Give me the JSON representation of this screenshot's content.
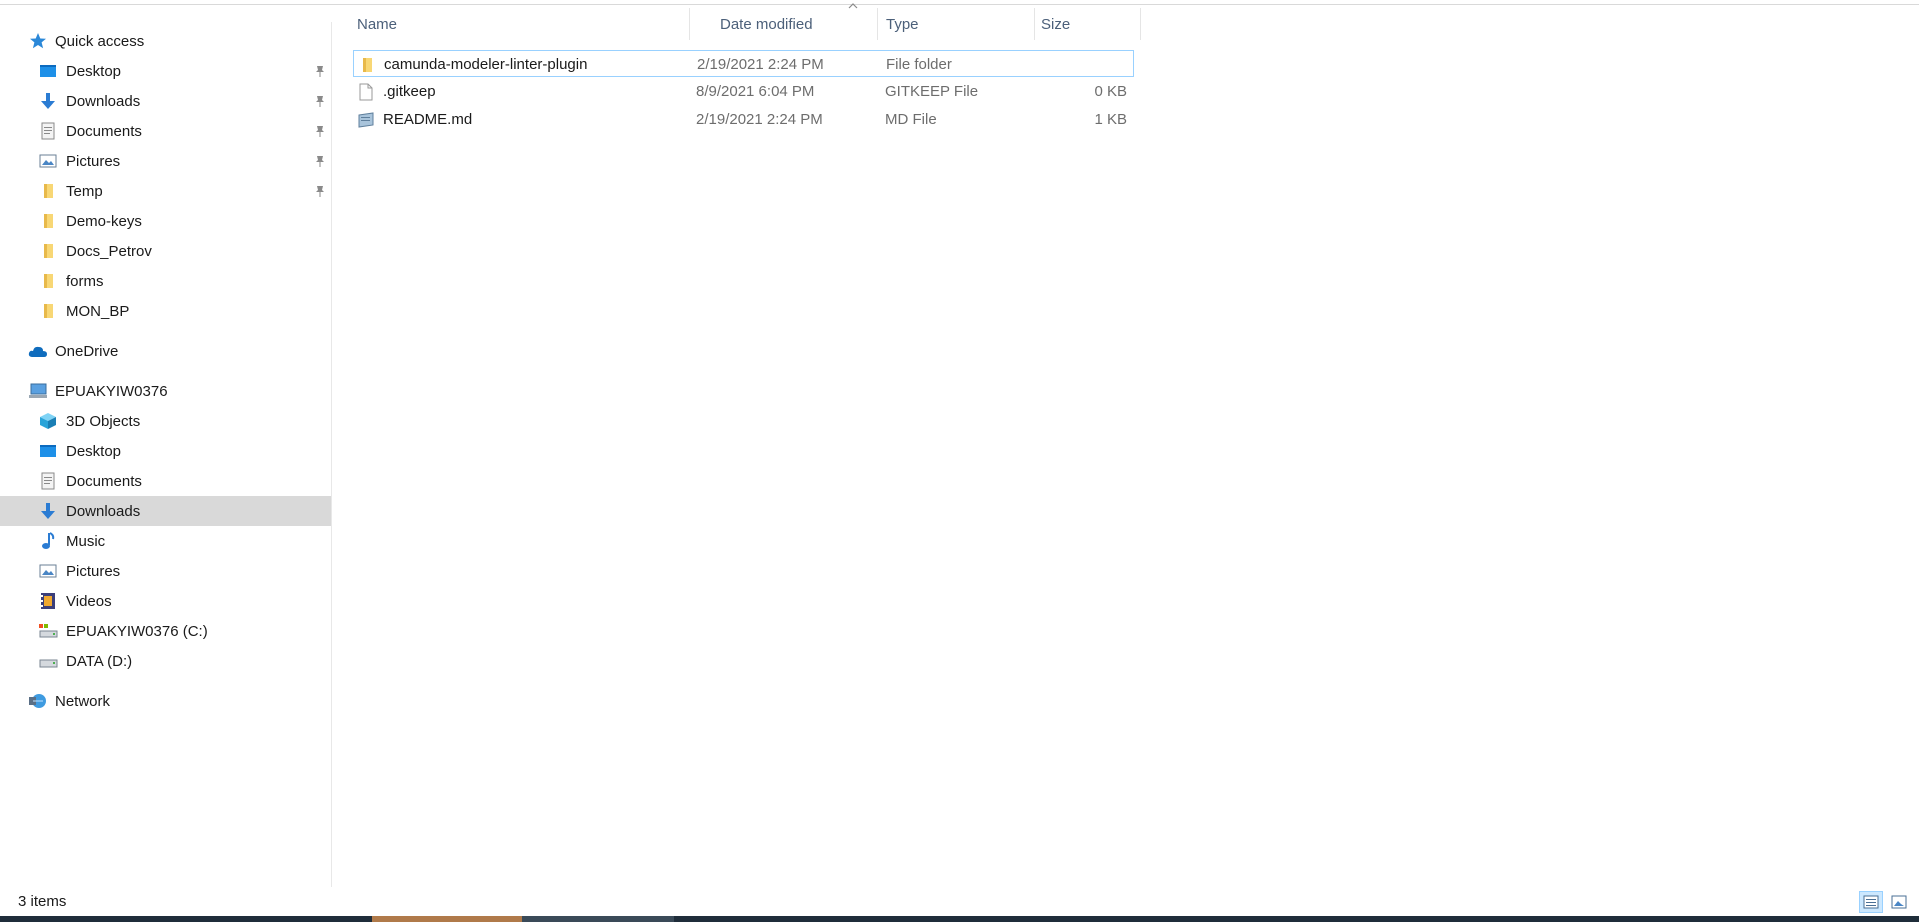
{
  "nav": {
    "quick_access": {
      "label": "Quick access",
      "items": [
        {
          "label": "Desktop",
          "icon": "desktop-icon",
          "pinned": true
        },
        {
          "label": "Downloads",
          "icon": "downloads-icon",
          "pinned": true
        },
        {
          "label": "Documents",
          "icon": "documents-icon",
          "pinned": true
        },
        {
          "label": "Pictures",
          "icon": "pictures-icon",
          "pinned": true
        },
        {
          "label": "Temp",
          "icon": "folder-icon",
          "pinned": true
        },
        {
          "label": "Demo-keys",
          "icon": "folder-icon",
          "pinned": false
        },
        {
          "label": "Docs_Petrov",
          "icon": "folder-icon",
          "pinned": false
        },
        {
          "label": "forms",
          "icon": "folder-icon",
          "pinned": false
        },
        {
          "label": "MON_BP",
          "icon": "folder-icon",
          "pinned": false
        }
      ]
    },
    "onedrive": {
      "label": "OneDrive"
    },
    "this_pc": {
      "label": "EPUAKYIW0376",
      "items": [
        {
          "label": "3D Objects",
          "icon": "3d-objects-icon"
        },
        {
          "label": "Desktop",
          "icon": "desktop-icon"
        },
        {
          "label": "Documents",
          "icon": "documents-icon"
        },
        {
          "label": "Downloads",
          "icon": "downloads-icon",
          "selected": true
        },
        {
          "label": "Music",
          "icon": "music-icon"
        },
        {
          "label": "Pictures",
          "icon": "pictures-icon"
        },
        {
          "label": "Videos",
          "icon": "videos-icon"
        },
        {
          "label": "EPUAKYIW0376 (C:)",
          "icon": "system-drive-icon"
        },
        {
          "label": "DATA (D:)",
          "icon": "drive-icon"
        }
      ]
    },
    "network": {
      "label": "Network"
    }
  },
  "list": {
    "columns": {
      "name": "Name",
      "date": "Date modified",
      "type": "Type",
      "size": "Size"
    },
    "rows": [
      {
        "name": "camunda-modeler-linter-plugin",
        "date": "2/19/2021 2:24 PM",
        "type": "File folder",
        "size": "",
        "icon": "folder-icon",
        "selected": true
      },
      {
        "name": ".gitkeep",
        "date": "8/9/2021 6:04 PM",
        "type": "GITKEEP File",
        "size": "0 KB",
        "icon": "file-icon"
      },
      {
        "name": "README.md",
        "date": "2/19/2021 2:24 PM",
        "type": "MD File",
        "size": "1 KB",
        "icon": "markdown-file-icon"
      }
    ]
  },
  "status": {
    "item_count": "3 items"
  },
  "colors": {
    "selection": "#cce8ff",
    "selection_border": "#99d1ff",
    "nav_selected": "#d9d9d9",
    "header_text": "#4c607a"
  }
}
